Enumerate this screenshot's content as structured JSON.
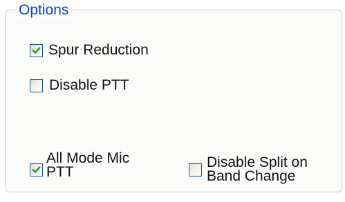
{
  "options_group": {
    "title": "Options",
    "checkboxes": [
      {
        "id": "spur_reduction",
        "label": "Spur Reduction",
        "checked": true
      },
      {
        "id": "disable_ptt",
        "label": "Disable PTT",
        "checked": false
      },
      {
        "id": "all_mode_mic_ptt",
        "label": "All Mode Mic PTT",
        "checked": true
      },
      {
        "id": "disable_split_on_band_change",
        "label": "Disable Split on Band Change",
        "checked": false
      }
    ]
  },
  "colors": {
    "group_title": "#0046d5",
    "checkmark": "#21a121",
    "checkbox_border": "#1c5180",
    "group_border": "#d0d0bf"
  },
  "icons": {
    "checked": "checkbox-checked-icon",
    "unchecked": "checkbox-unchecked-icon"
  }
}
